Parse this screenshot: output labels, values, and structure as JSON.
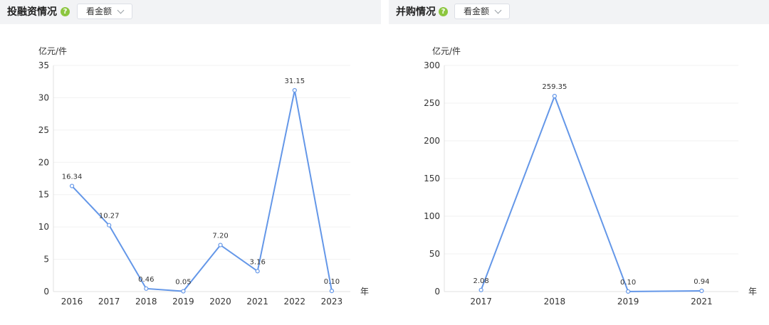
{
  "panels": [
    {
      "title": "投融资情况",
      "help_icon": "question-circle-icon",
      "select_value": "看金额",
      "y_unit": "亿元/件",
      "x_unit": "年"
    },
    {
      "title": "并购情况",
      "help_icon": "question-circle-icon",
      "select_value": "看金额",
      "y_unit": "亿元/件",
      "x_unit": "年"
    }
  ],
  "colors": {
    "line": "#6497e8",
    "help_icon": "#8cc63f",
    "header_bg": "#f2f3f5"
  },
  "chart_data": [
    {
      "type": "line",
      "title": "",
      "xlabel": "年",
      "ylabel": "亿元/件",
      "categories": [
        "2016",
        "2017",
        "2018",
        "2019",
        "2020",
        "2021",
        "2022",
        "2023"
      ],
      "values": [
        16.34,
        10.27,
        0.46,
        0.05,
        7.2,
        3.16,
        31.15,
        0.1
      ],
      "data_labels": [
        "16.34",
        "10.27",
        "0.46",
        "0.05",
        "7.20",
        "3.16",
        "31.15",
        "0.10"
      ],
      "yticks": [
        0,
        5,
        10,
        15,
        20,
        25,
        30,
        35
      ],
      "ylim": [
        0,
        35
      ],
      "grid": true,
      "legend": false
    },
    {
      "type": "line",
      "title": "",
      "xlabel": "年",
      "ylabel": "亿元/件",
      "categories": [
        "2017",
        "2018",
        "2019",
        "2021"
      ],
      "values": [
        2.08,
        259.35,
        0.1,
        0.94
      ],
      "data_labels": [
        "2.08",
        "259.35",
        "0.10",
        "0.94"
      ],
      "yticks": [
        0,
        50,
        100,
        150,
        200,
        250,
        300
      ],
      "ylim": [
        0,
        300
      ],
      "grid": true,
      "legend": false
    }
  ]
}
